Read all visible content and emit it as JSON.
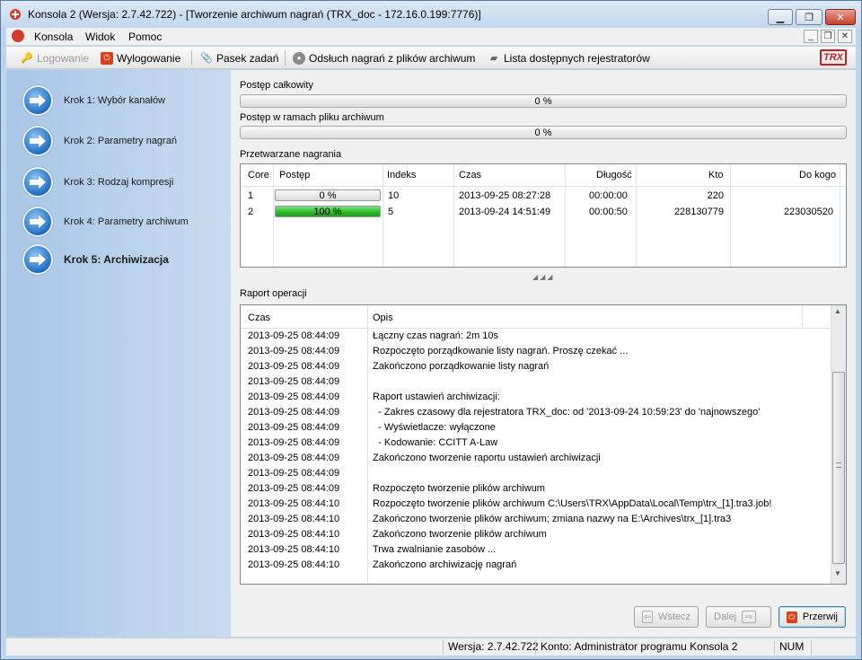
{
  "window": {
    "title": "Konsola 2 (Wersja:  2.7.42.722) - [Tworzenie archiwum nagrań (TRX_doc - 172.16.0.199:7776)]"
  },
  "menu": {
    "items": [
      "Konsola",
      "Widok",
      "Pomoc"
    ]
  },
  "toolbar": {
    "login": "Logowanie",
    "logout": "Wylogowanie",
    "taskbar": "Pasek zadań",
    "playback": "Odsłuch nagrań z plików archiwum",
    "recorders": "Lista dostępnych rejestratorów",
    "logo": "TRX"
  },
  "steps": [
    {
      "label": "Krok 1: Wybór kanałów"
    },
    {
      "label": "Krok 2: Parametry nagrań"
    },
    {
      "label": "Krok 3: Rodzaj kompresji"
    },
    {
      "label": "Krok 4: Parametry archiwum"
    },
    {
      "label": "Krok 5: Archiwizacja"
    }
  ],
  "progress": {
    "total_label": "Postęp całkowity",
    "total_value": "0 %",
    "file_label": "Postęp w ramach pliku archiwum",
    "file_value": "0 %"
  },
  "recordings": {
    "label": "Przetwarzane nagrania",
    "headers": [
      "Core",
      "Postęp",
      "Indeks",
      "Czas",
      "Długość",
      "Kto",
      "Do kogo"
    ],
    "rows": [
      {
        "core": "1",
        "progress_text": "0 %",
        "progress": 0,
        "index": "10",
        "time": "2013-09-25 08:27:28",
        "length": "00:00:00",
        "who": "220",
        "to": ""
      },
      {
        "core": "2",
        "progress_text": "100 %",
        "progress": 100,
        "index": "5",
        "time": "2013-09-24 14:51:49",
        "length": "00:00:50",
        "who": "228130779",
        "to": "223030520"
      }
    ]
  },
  "report": {
    "label": "Raport operacji",
    "headers": [
      "Czas",
      "Opis"
    ],
    "rows": [
      {
        "time": "2013-09-25 08:44:09",
        "desc": "Łączny czas nagrań: 2m 10s"
      },
      {
        "time": "2013-09-25 08:44:09",
        "desc": "Rozpoczęto porządkowanie listy nagrań. Proszę czekać ..."
      },
      {
        "time": "2013-09-25 08:44:09",
        "desc": "Zakończono porządkowanie listy nagrań"
      },
      {
        "time": "2013-09-25 08:44:09",
        "desc": ""
      },
      {
        "time": "2013-09-25 08:44:09",
        "desc": "Raport ustawień archiwizacji:"
      },
      {
        "time": "2013-09-25 08:44:09",
        "desc": "  - Zakres czasowy dla rejestratora TRX_doc: od '2013-09-24 10:59:23' do 'najnowszego'"
      },
      {
        "time": "2013-09-25 08:44:09",
        "desc": "  - Wyświetlacze: wyłączone"
      },
      {
        "time": "2013-09-25 08:44:09",
        "desc": "  - Kodowanie: CCITT A-Law"
      },
      {
        "time": "2013-09-25 08:44:09",
        "desc": "Zakończono tworzenie raportu ustawień archiwizacji"
      },
      {
        "time": "2013-09-25 08:44:09",
        "desc": ""
      },
      {
        "time": "2013-09-25 08:44:09",
        "desc": "Rozpoczęto tworzenie plików archiwum"
      },
      {
        "time": "2013-09-25 08:44:10",
        "desc": "Rozpoczęto tworzenie plików archiwum C:\\Users\\TRX\\AppData\\Local\\Temp\\trx_[1].tra3.job!"
      },
      {
        "time": "2013-09-25 08:44:10",
        "desc": "Zakończono tworzenie plików archiwum; zmiana nazwy na E:\\Archives\\trx_[1].tra3"
      },
      {
        "time": "2013-09-25 08:44:10",
        "desc": "Zakończono tworzenie plików archiwum"
      },
      {
        "time": "2013-09-25 08:44:10",
        "desc": "Trwa zwalnianie zasobów ..."
      },
      {
        "time": "2013-09-25 08:44:10",
        "desc": "Zakończono archiwizację nagrań"
      }
    ]
  },
  "buttons": {
    "back": "Wstecz",
    "next": "Dalej",
    "abort": "Przerwij"
  },
  "status": {
    "version": "Wersja: 2.7.42.722",
    "account": "Konto: Administrator programu Konsola 2",
    "num": "NUM"
  }
}
